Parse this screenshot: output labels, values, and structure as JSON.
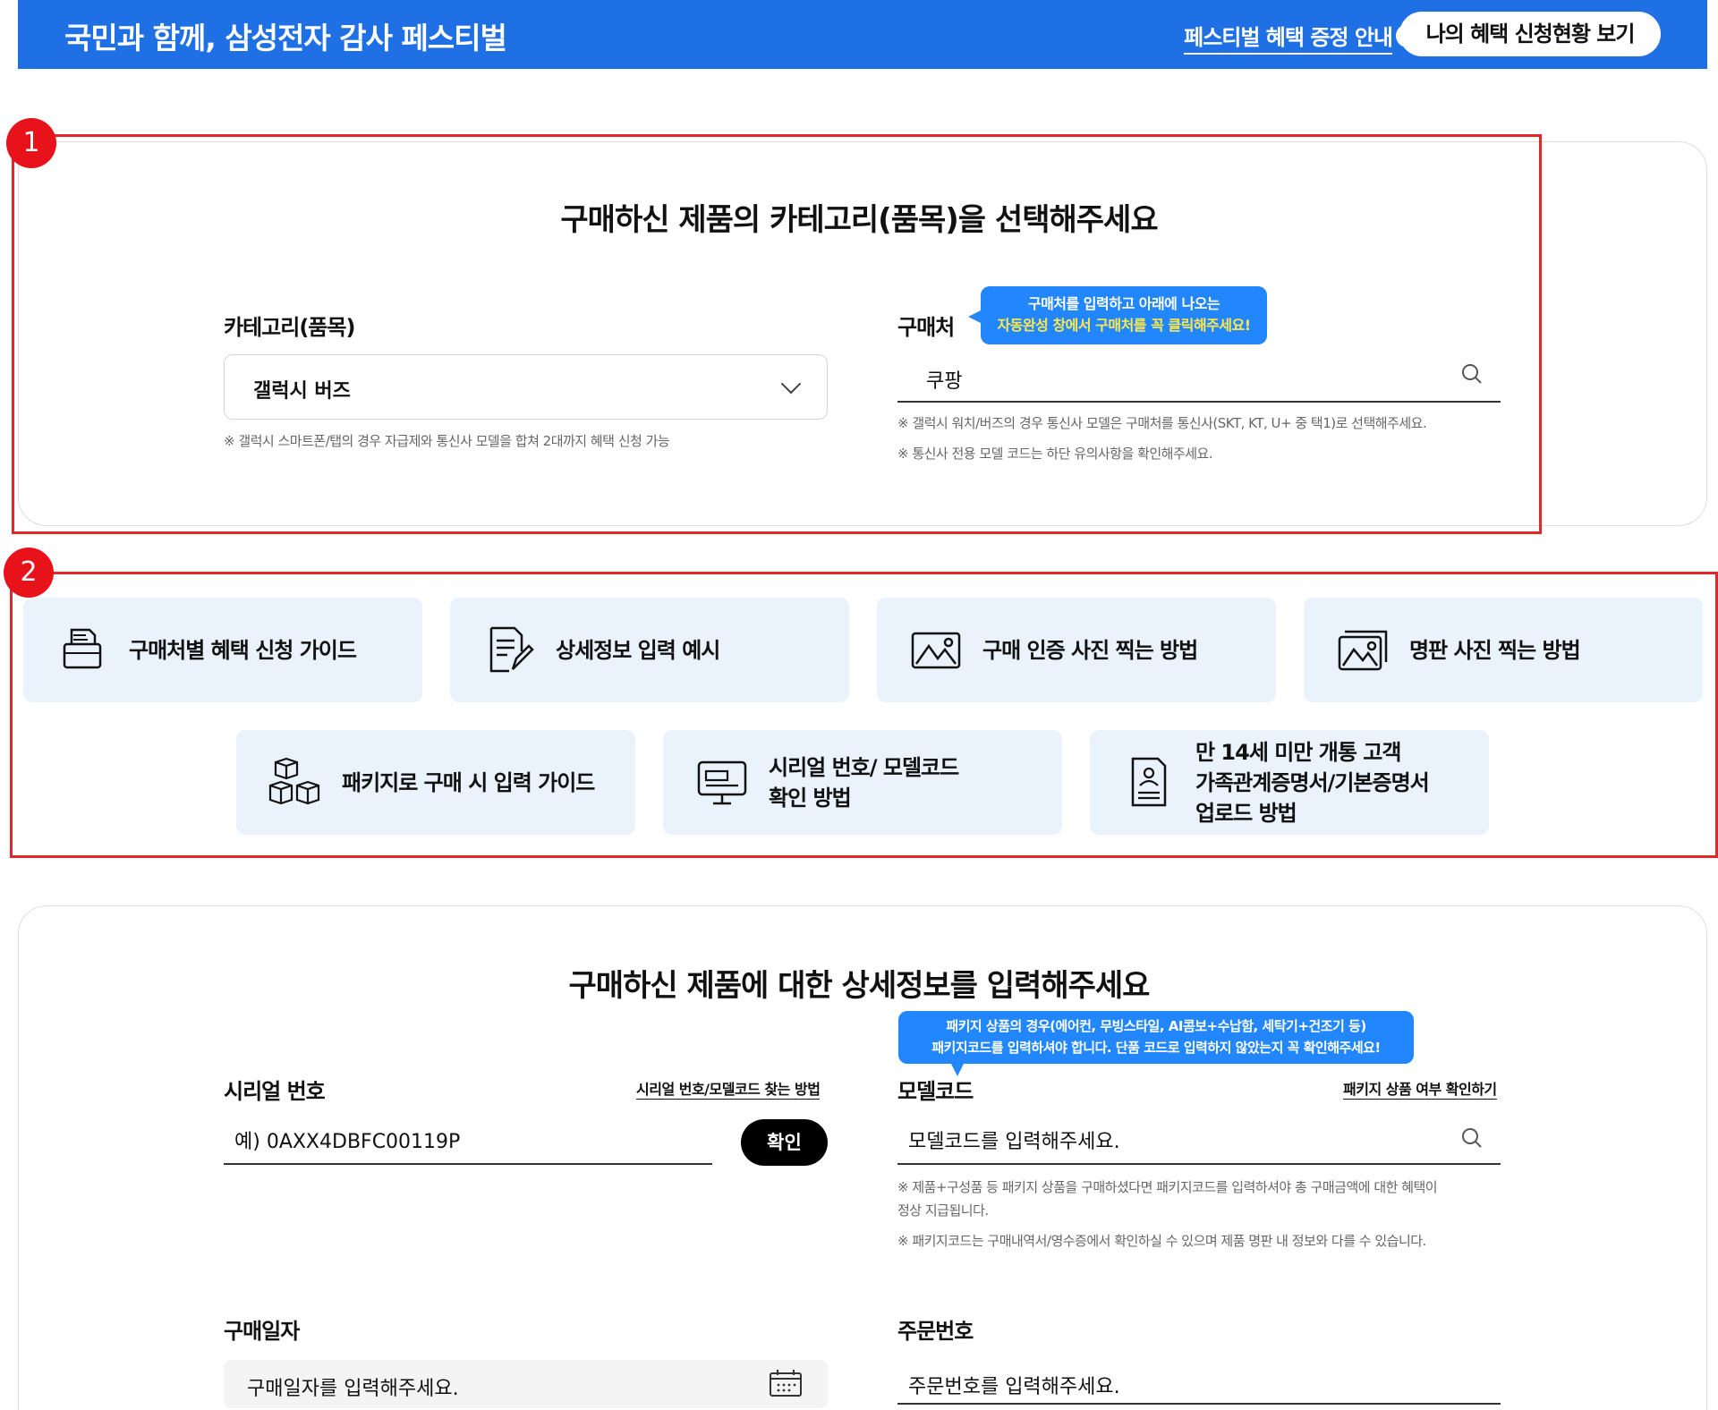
{
  "header": {
    "title": "국민과 함께, 삼성전자 감사 페스티벌",
    "guide_link": "페스티벌 혜택 증정 안내",
    "my_benefit_button": "나의 혜택 신청현황 보기"
  },
  "markers": {
    "step1": "1",
    "step2": "2"
  },
  "category_section": {
    "title": "구매하신 제품의 카테고리(품목)을 선택해주세요",
    "category_label": "카테고리(품목)",
    "category_value": "갤럭시 버즈",
    "category_note": "※ 갤럭시 스마트폰/탭의 경우 자급제와 통신사 모델을 합쳐 2대까지 혜택 신청 가능",
    "store_label": "구매처",
    "store_value": "쿠팡",
    "store_tooltip_line1": "구매처를 입력하고 아래에 나오는",
    "store_tooltip_line2": "자동완성 창에서 구매처를 꼭 클릭해주세요!",
    "store_note1": "※ 갤럭시 워치/버즈의 경우 통신사 모델은 구매처를 통신사(SKT, KT, U+ 중 택1)로 선택해주세요.",
    "store_note2": "※ 통신사 전용 모델 코드는 하단 유의사항을 확인해주세요."
  },
  "guides": [
    {
      "label": "구매처별 혜택 신청 가이드",
      "icon": "printer-icon"
    },
    {
      "label": "상세정보 입력 예시",
      "icon": "document-edit-icon"
    },
    {
      "label": "구매 인증 사진 찍는 방법",
      "icon": "photo-icon"
    },
    {
      "label": "명판 사진 찍는 방법",
      "icon": "photos-icon"
    },
    {
      "label": "패키지로 구매 시 입력 가이드",
      "icon": "boxes-icon"
    },
    {
      "label": "시리얼 번호/ 모델코드\n확인 방법",
      "icon": "monitor-icon"
    },
    {
      "label": "만 14세 미만 개통 고객\n가족관계증명서/기본증명서\n업로드 방법",
      "icon": "certificate-icon"
    }
  ],
  "detail_section": {
    "title": "구매하신 제품에 대한 상세정보를 입력해주세요",
    "serial_label": "시리얼 번호",
    "serial_help_link": "시리얼 번호/모델코드 찾는 방법",
    "serial_placeholder": "예) 0AXX4DBFC00119P",
    "confirm_button": "확인",
    "model_label": "모델코드",
    "model_tooltip_line1": "패키지 상품의 경우(에어컨, 무빙스타일, AI콤보+수납함, 세탁기+건조기 등)",
    "model_tooltip_line2": "패키지코드를 입력하셔야 합니다. 단품 코드로 입력하지 않았는지 꼭 확인해주세요!",
    "package_check_link": "패키지 상품 여부 확인하기",
    "model_placeholder": "모델코드를 입력해주세요.",
    "model_note1a": "※ 제품+구성품 등 패키지 상품을 구매하셨다면 패키지코드를 입력하셔야 총 구매금액에 대한 혜택이",
    "model_note1b": "정상 지급됩니다.",
    "model_note2": "※ 패키지코드는 구매내역서/영수증에서 확인하실 수 있으며 제품 명판 내 정보와 다를 수 있습니다.",
    "date_label": "구매일자",
    "date_placeholder": "구매일자를 입력해주세요.",
    "order_label": "주문번호",
    "order_placeholder": "주문번호를 입력해주세요."
  },
  "colors": {
    "brand_blue": "#1f6fe5",
    "highlight_red": "#e3262a",
    "guide_bg": "#eaf2fc",
    "tooltip_blue": "#2286ff"
  }
}
